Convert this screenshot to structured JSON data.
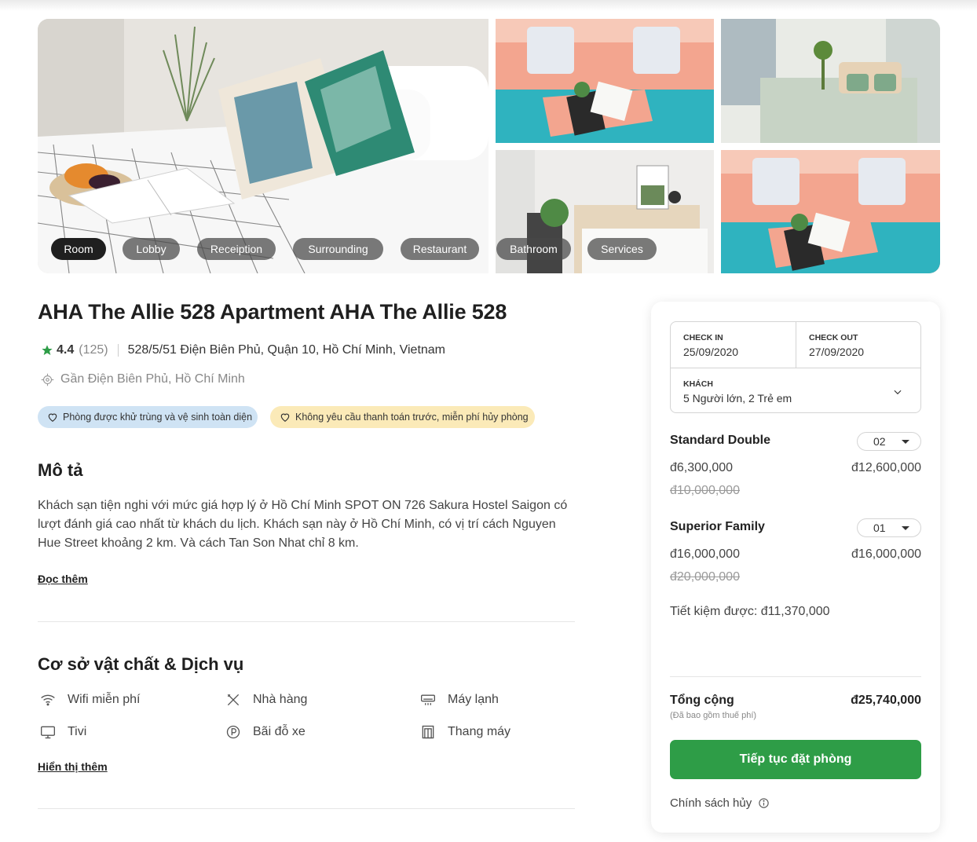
{
  "gallery": {
    "tags": [
      "Room",
      "Lobby",
      "Receiption",
      "Surrounding",
      "Restaurant",
      "Bathroom",
      "Services"
    ],
    "active_tag": "Room"
  },
  "hotel": {
    "title": "AHA The Allie 528 Apartment AHA The Allie 528",
    "rating": "4.4",
    "review_count": "(125)",
    "address": "528/5/51 Điện Biên Phủ, Quận 10, Hồ Chí Minh, Vietnam",
    "nearby": "Gần Điện Biên Phủ, Hồ Chí Minh",
    "badges": [
      "Phòng được khử trùng và vệ sinh toàn diện",
      "Không yêu cầu thanh toán trước, miễn phí hủy phòng"
    ]
  },
  "description": {
    "heading": "Mô tả",
    "text": "Khách sạn tiện nghi với mức giá hợp lý ở Hồ Chí Minh SPOT ON 726 Sakura Hostel Saigon có lượt đánh giá cao nhất từ khách du lịch. Khách sạn này ở Hồ Chí Minh, có vị trí cách Nguyen Hue Street khoảng 2 km. Và cách Tan Son Nhat chỉ 8 km.",
    "read_more": "Đọc thêm"
  },
  "amenities": {
    "heading": "Cơ sở vật chất & Dịch vụ",
    "items": [
      "Wifi miễn phí",
      "Nhà hàng",
      "Máy lạnh",
      "Tivi",
      "Bãi đỗ xe",
      "Thang máy"
    ],
    "show_more": "Hiển thị thêm"
  },
  "booking": {
    "check_in_label": "CHECK IN",
    "check_in_value": "25/09/2020",
    "check_out_label": "CHECK OUT",
    "check_out_value": "27/09/2020",
    "guests_label": "KHÁCH",
    "guests_value": "5 Người lớn, 2 Trẻ em",
    "rooms": [
      {
        "name": "Standard Double",
        "qty": "02",
        "unit_price": "đ6,300,000",
        "old_price": "đ10,000,000",
        "subtotal": "đ12,600,000"
      },
      {
        "name": "Superior Family",
        "qty": "01",
        "unit_price": "đ16,000,000",
        "old_price": "đ20,000,000",
        "subtotal": "đ16,000,000"
      }
    ],
    "saving": "Tiết kiệm được:  đ11,370,000",
    "total_label": "Tổng cộng",
    "total_note": "(Đã bao gồm thuế phí)",
    "total_value": "đ25,740,000",
    "cta_label": "Tiếp tục đặt phòng",
    "policy_label": "Chính sách hủy"
  },
  "colors": {
    "primary_green": "#2e9d47",
    "star": "#2e9d47",
    "badge_blue": "#cfe3f4",
    "badge_yellow": "#fbeab8"
  }
}
